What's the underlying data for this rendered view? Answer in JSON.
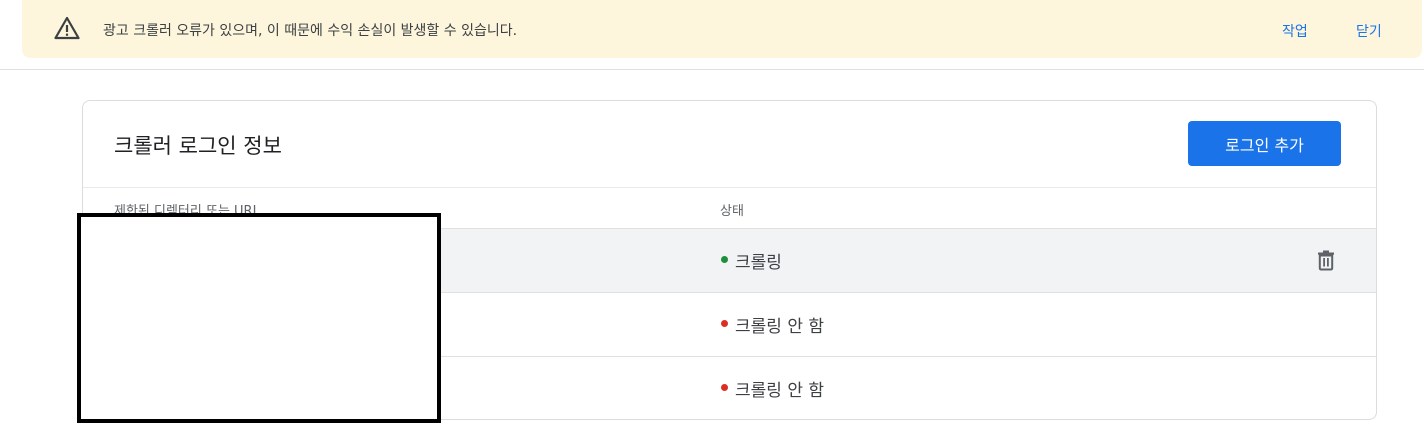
{
  "banner": {
    "message": "광고 크롤러 오류가 있으며, 이 때문에 수익 손실이 발생할 수 있습니다.",
    "action_label": "작업",
    "close_label": "닫기",
    "icon": "warning-icon"
  },
  "card": {
    "title": "크롤러 로그인 정보",
    "add_button_label": "로그인 추가"
  },
  "table": {
    "columns": [
      "제한된 디렉터리 또는 URL",
      "상태"
    ],
    "rows": [
      {
        "path": "",
        "status": "크롤링",
        "status_color": "#1e8e3e"
      },
      {
        "path": "",
        "status": "크롤링 안 함",
        "status_color": "#d93025"
      },
      {
        "path": "",
        "status": "크롤링 안 함",
        "status_color": "#d93025"
      }
    ]
  },
  "colors": {
    "accent": "#1a73e8",
    "banner_bg": "#fdf6dd",
    "ok": "#1e8e3e",
    "error": "#d93025"
  }
}
